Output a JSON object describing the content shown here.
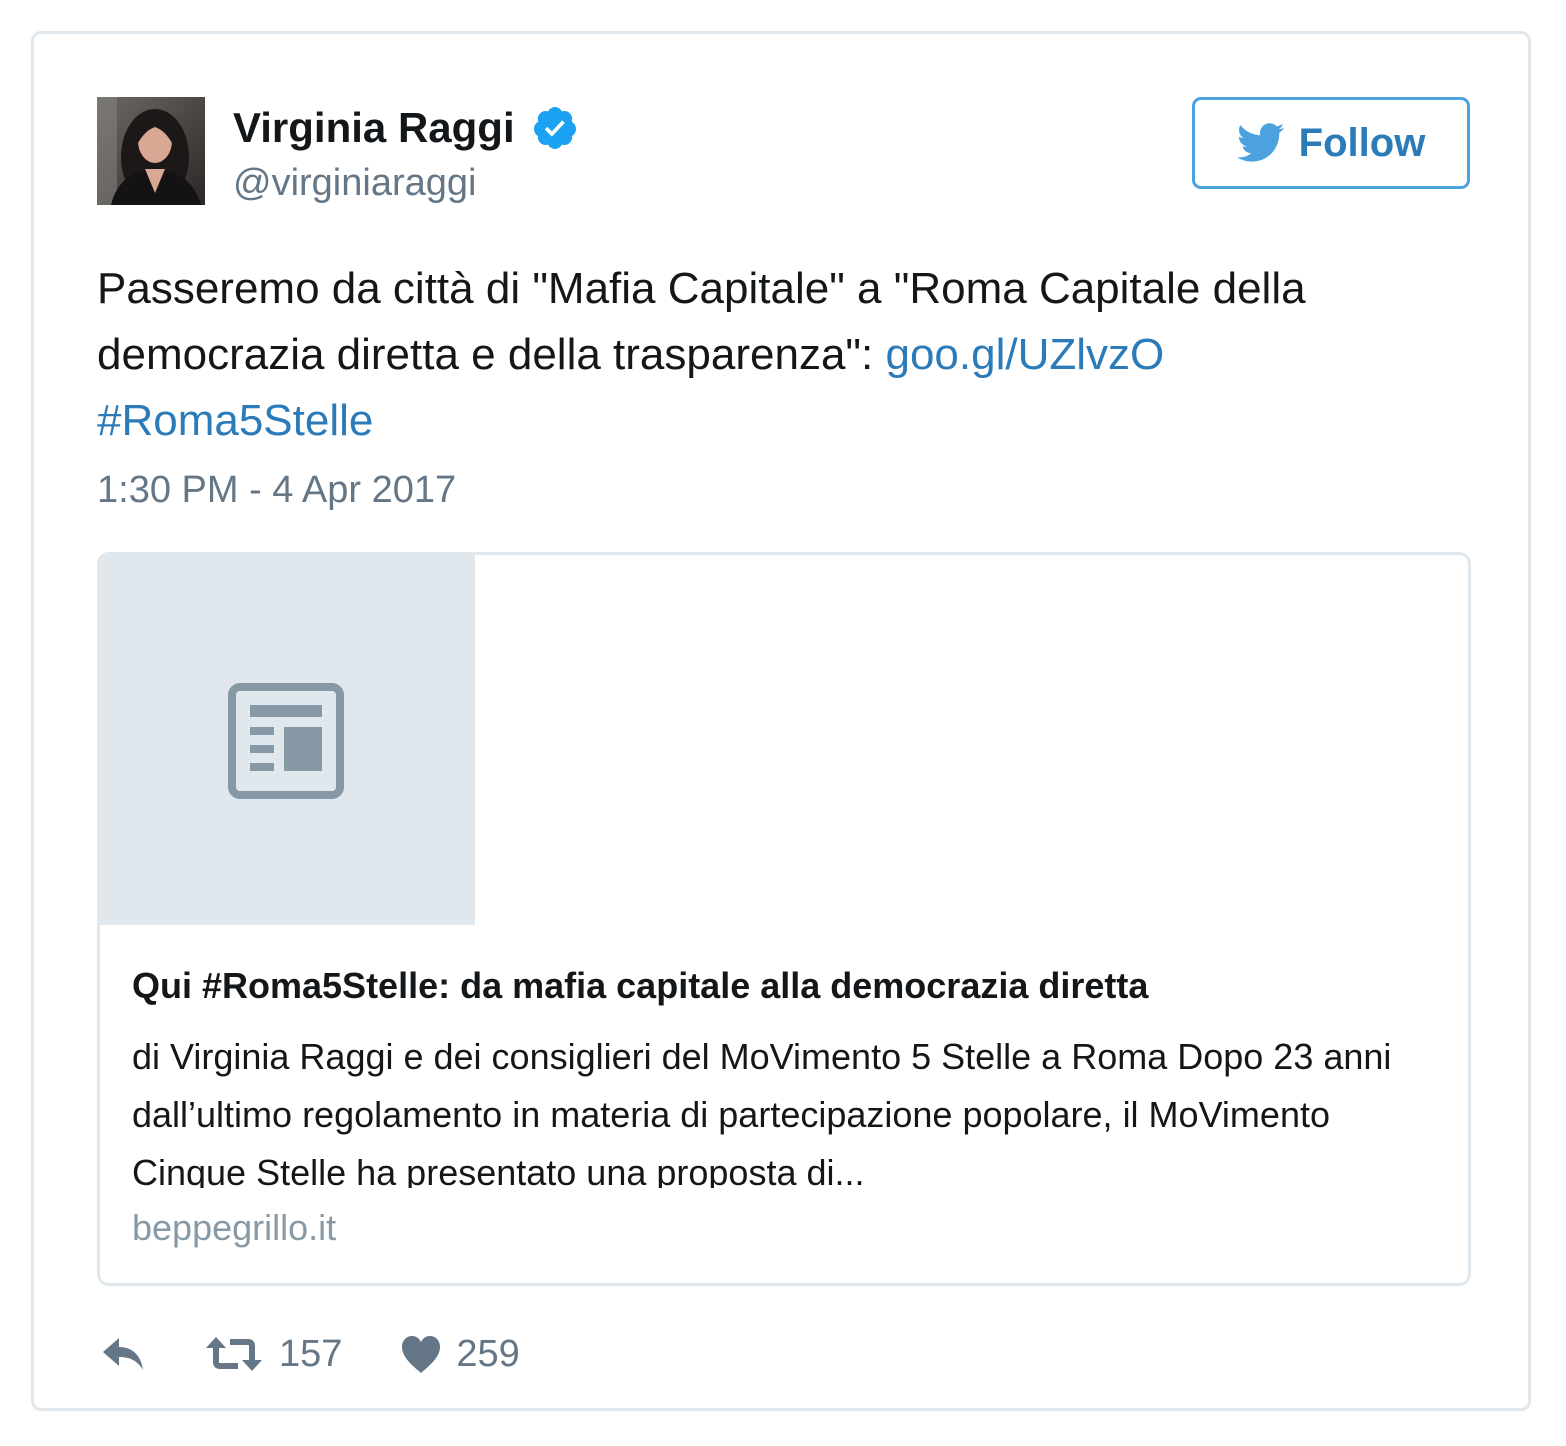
{
  "author": {
    "name": "Virginia Raggi",
    "handle": "@virginiaraggi",
    "verified": true,
    "verified_icon": "verified-badge-icon",
    "verified_color": "#1da1f2"
  },
  "follow_button": {
    "label": "Follow",
    "icon": "twitter-bird-icon",
    "color": "#2b7bb9"
  },
  "tweet": {
    "text_before_link": "Passeremo da città di \"Mafia Capitale\" a \"Roma Capitale della democrazia diretta e della trasparenza\": ",
    "link": "goo.gl/UZlvzO",
    "hashtag": "#Roma5Stelle",
    "timestamp": "1:30 PM - 4 Apr 2017",
    "link_color": "#2b7bb9"
  },
  "card": {
    "thumbnail_icon": "article-icon",
    "title": "Qui #Roma5Stelle: da mafia capitale alla democrazia diretta",
    "description": "di Virginia Raggi e dei consiglieri del MoVimento 5 Stelle a Roma Dopo 23 anni dall’ultimo regolamento in materia di partecipazione popolare, il MoVimento Cinque Stelle ha presentato una proposta di...",
    "domain": "beppegrillo.it"
  },
  "actions": {
    "reply_icon": "reply-icon",
    "retweet_icon": "retweet-icon",
    "retweet_count": "157",
    "like_icon": "heart-icon",
    "like_count": "259"
  }
}
